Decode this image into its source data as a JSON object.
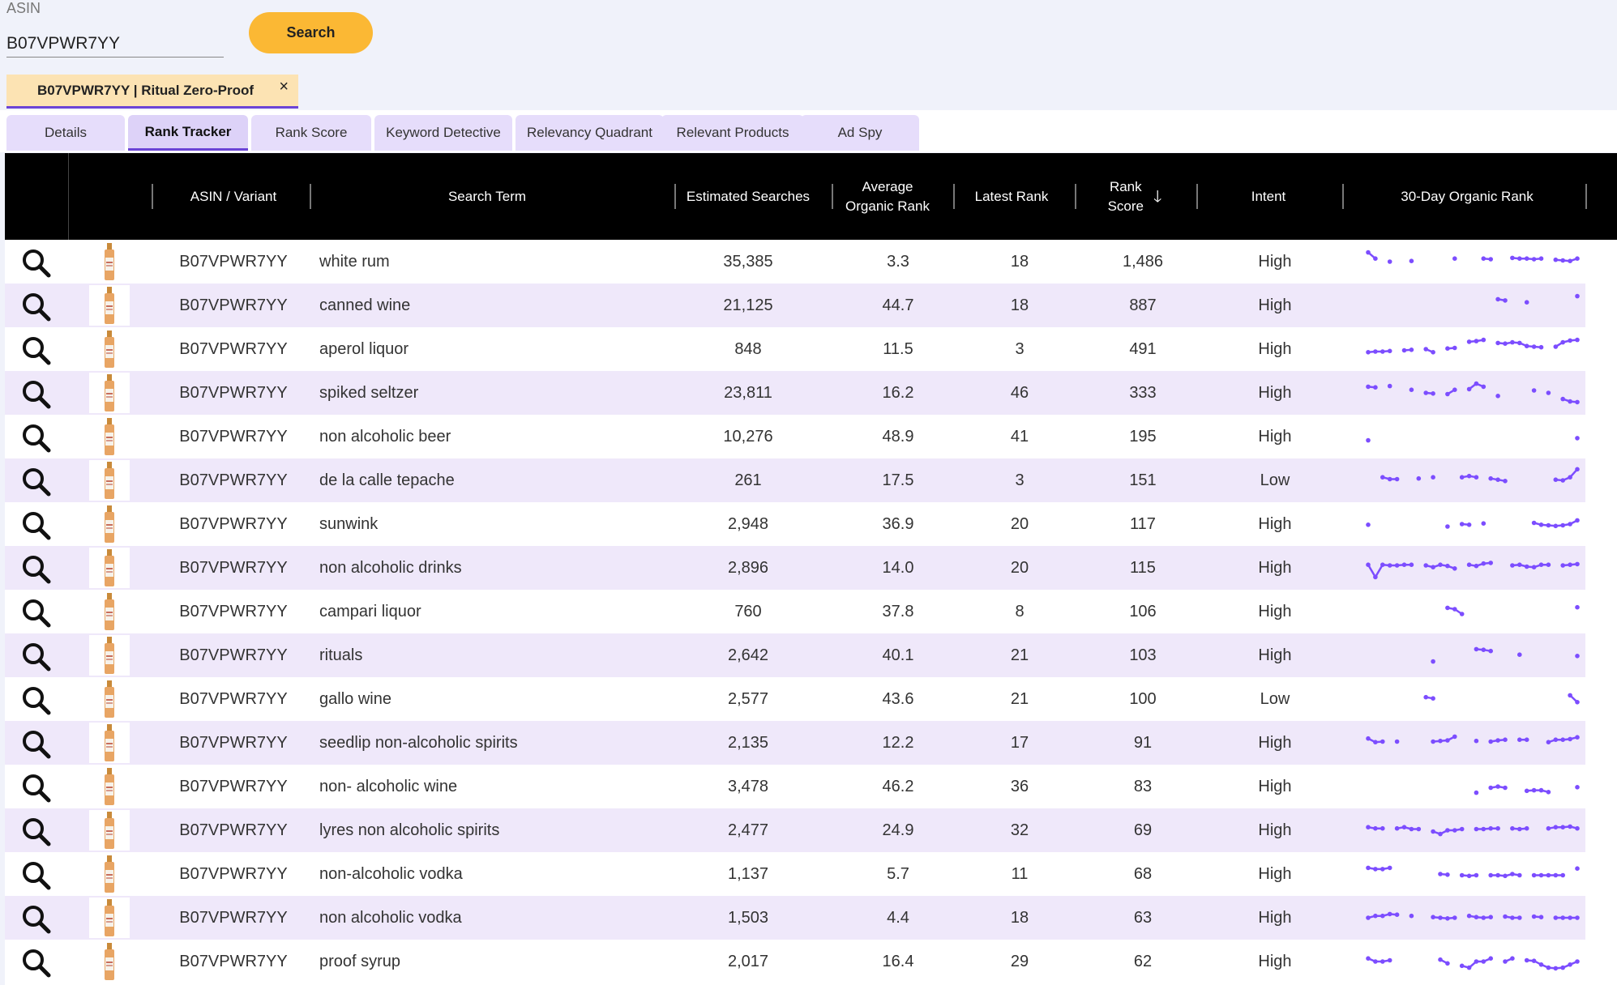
{
  "search": {
    "label": "ASIN",
    "value": "B07VPWR7YY",
    "button": "Search"
  },
  "chip": {
    "label": "B07VPWR7YY | Ritual Zero-Proof",
    "close": "×"
  },
  "tabs": [
    "Details",
    "Rank Tracker",
    "Rank Score",
    "Keyword Detective",
    "Relevancy Quadrant",
    "Relevant Products",
    "Ad Spy"
  ],
  "active_tab": "Rank Tracker",
  "columns": {
    "asin": "ASIN / Variant",
    "term": "Search Term",
    "est": "Estimated Searches",
    "avg1": "Average",
    "avg2": "Organic Rank",
    "latest": "Latest Rank",
    "rs1": "Rank",
    "rs2": "Score",
    "intent": "Intent",
    "spark": "30-Day Organic Rank"
  },
  "accent_color": "#7c4dff",
  "rows": [
    {
      "asin": "B07VPWR7YY",
      "term": "white rum",
      "est": "35,385",
      "avg": "3.3",
      "latest": "18",
      "score": "1,486",
      "intent": "High",
      "trend": [
        20,
        40,
        null,
        50,
        null,
        null,
        48,
        null,
        null,
        null,
        null,
        null,
        40,
        null,
        null,
        null,
        40,
        42,
        null,
        null,
        38,
        40,
        40,
        42,
        40,
        null,
        44,
        46,
        48,
        40
      ]
    },
    {
      "asin": "B07VPWR7YY",
      "term": "canned wine",
      "est": "21,125",
      "avg": "44.7",
      "latest": "18",
      "score": "887",
      "intent": "High",
      "trend": [
        null,
        null,
        null,
        null,
        null,
        null,
        null,
        null,
        null,
        null,
        null,
        null,
        null,
        null,
        null,
        null,
        null,
        null,
        30,
        34,
        null,
        null,
        40,
        null,
        null,
        null,
        null,
        null,
        null,
        20
      ]
    },
    {
      "asin": "B07VPWR7YY",
      "term": "aperol liquor",
      "est": "848",
      "avg": "11.5",
      "latest": "3",
      "score": "491",
      "intent": "High",
      "trend": [
        60,
        58,
        58,
        56,
        null,
        54,
        52,
        null,
        50,
        60,
        null,
        48,
        46,
        null,
        26,
        24,
        20,
        null,
        30,
        32,
        28,
        30,
        40,
        42,
        44,
        null,
        42,
        28,
        22,
        20
      ]
    },
    {
      "asin": "B07VPWR7YY",
      "term": "spiked seltzer",
      "est": "23,811",
      "avg": "16.2",
      "latest": "46",
      "score": "333",
      "intent": "High",
      "trend": [
        30,
        32,
        null,
        28,
        null,
        null,
        40,
        null,
        50,
        52,
        null,
        54,
        40,
        null,
        38,
        20,
        30,
        null,
        60,
        null,
        null,
        null,
        null,
        42,
        null,
        50,
        null,
        70,
        78,
        80
      ]
    },
    {
      "asin": "B07VPWR7YY",
      "term": "non alcoholic beer",
      "est": "10,276",
      "avg": "48.9",
      "latest": "41",
      "score": "195",
      "intent": "High",
      "trend": [
        62,
        null,
        null,
        null,
        null,
        null,
        null,
        null,
        null,
        null,
        null,
        null,
        null,
        null,
        null,
        null,
        null,
        null,
        null,
        null,
        null,
        null,
        null,
        null,
        null,
        null,
        null,
        null,
        null,
        55
      ]
    },
    {
      "asin": "B07VPWR7YY",
      "term": "de la calle tepache",
      "est": "261",
      "avg": "17.5",
      "latest": "3",
      "score": "151",
      "intent": "Low",
      "trend": [
        null,
        null,
        40,
        46,
        46,
        null,
        null,
        44,
        null,
        40,
        null,
        null,
        null,
        40,
        36,
        40,
        null,
        44,
        48,
        52,
        null,
        null,
        null,
        null,
        null,
        null,
        48,
        50,
        40,
        14
      ]
    },
    {
      "asin": "B07VPWR7YY",
      "term": "sunwink",
      "est": "2,948",
      "avg": "36.9",
      "latest": "20",
      "score": "117",
      "intent": "High",
      "trend": [
        52,
        null,
        null,
        null,
        null,
        null,
        null,
        null,
        null,
        null,
        null,
        58,
        null,
        50,
        52,
        null,
        48,
        null,
        null,
        null,
        null,
        null,
        null,
        46,
        52,
        54,
        56,
        54,
        50,
        38
      ]
    },
    {
      "asin": "B07VPWR7YY",
      "term": "non alcoholic drinks",
      "est": "2,896",
      "avg": "14.0",
      "latest": "20",
      "score": "115",
      "intent": "High",
      "trend": [
        40,
        80,
        40,
        42,
        42,
        40,
        40,
        null,
        42,
        48,
        40,
        44,
        52,
        null,
        40,
        44,
        36,
        34,
        null,
        null,
        42,
        40,
        46,
        48,
        40,
        40,
        null,
        42,
        40,
        38
      ]
    },
    {
      "asin": "B07VPWR7YY",
      "term": "campari liquor",
      "est": "760",
      "avg": "37.8",
      "latest": "8",
      "score": "106",
      "intent": "High",
      "trend": [
        null,
        null,
        null,
        null,
        null,
        null,
        null,
        null,
        null,
        null,
        null,
        38,
        42,
        58,
        null,
        null,
        null,
        null,
        null,
        null,
        null,
        null,
        null,
        null,
        null,
        null,
        null,
        null,
        null,
        36
      ]
    },
    {
      "asin": "B07VPWR7YY",
      "term": "rituals",
      "est": "2,642",
      "avg": "40.1",
      "latest": "21",
      "score": "103",
      "intent": "High",
      "trend": [
        null,
        null,
        null,
        null,
        null,
        null,
        null,
        null,
        null,
        70,
        null,
        null,
        null,
        null,
        null,
        30,
        32,
        36,
        null,
        null,
        null,
        48,
        null,
        null,
        null,
        null,
        null,
        null,
        null,
        52
      ]
    },
    {
      "asin": "B07VPWR7YY",
      "term": "gallo wine",
      "est": "2,577",
      "avg": "43.6",
      "latest": "21",
      "score": "100",
      "intent": "Low",
      "trend": [
        null,
        null,
        null,
        null,
        null,
        null,
        null,
        null,
        44,
        48,
        null,
        null,
        null,
        null,
        null,
        null,
        null,
        null,
        null,
        null,
        null,
        null,
        null,
        null,
        null,
        null,
        null,
        null,
        38,
        60
      ]
    },
    {
      "asin": "B07VPWR7YY",
      "term": "seedlip non-alcoholic spirits",
      "est": "2,135",
      "avg": "12.2",
      "latest": "17",
      "score": "91",
      "intent": "High",
      "trend": [
        36,
        48,
        46,
        null,
        46,
        null,
        null,
        null,
        null,
        46,
        44,
        42,
        30,
        null,
        null,
        44,
        null,
        46,
        42,
        40,
        null,
        40,
        40,
        null,
        null,
        48,
        40,
        40,
        38,
        32
      ]
    },
    {
      "asin": "B07VPWR7YY",
      "term": "non- alcoholic wine",
      "est": "3,478",
      "avg": "46.2",
      "latest": "36",
      "score": "83",
      "intent": "High",
      "trend": [
        null,
        null,
        null,
        null,
        null,
        null,
        null,
        null,
        null,
        null,
        null,
        null,
        null,
        null,
        null,
        70,
        null,
        54,
        50,
        54,
        null,
        null,
        64,
        62,
        62,
        68,
        null,
        null,
        null,
        52
      ]
    },
    {
      "asin": "B07VPWR7YY",
      "term": "lyres non alcoholic spirits",
      "est": "2,477",
      "avg": "24.9",
      "latest": "32",
      "score": "69",
      "intent": "High",
      "trend": [
        40,
        44,
        44,
        null,
        44,
        40,
        46,
        46,
        null,
        54,
        62,
        50,
        50,
        46,
        null,
        46,
        46,
        44,
        44,
        null,
        44,
        46,
        44,
        null,
        null,
        44,
        40,
        40,
        38,
        44
      ]
    },
    {
      "asin": "B07VPWR7YY",
      "term": "non-alcoholic vodka",
      "est": "1,137",
      "avg": "5.7",
      "latest": "11",
      "score": "68",
      "intent": "High",
      "trend": [
        30,
        34,
        34,
        30,
        null,
        null,
        null,
        null,
        null,
        null,
        50,
        52,
        null,
        54,
        56,
        54,
        null,
        54,
        54,
        56,
        50,
        54,
        null,
        54,
        54,
        54,
        54,
        54,
        null,
        32
      ]
    },
    {
      "asin": "B07VPWR7YY",
      "term": "non alcoholic vodka",
      "est": "1,503",
      "avg": "4.4",
      "latest": "18",
      "score": "63",
      "intent": "High",
      "trend": [
        50,
        44,
        44,
        38,
        40,
        null,
        44,
        null,
        null,
        48,
        50,
        52,
        50,
        null,
        44,
        48,
        50,
        48,
        null,
        46,
        50,
        50,
        null,
        46,
        48,
        null,
        50,
        50,
        50,
        50
      ]
    },
    {
      "asin": "B07VPWR7YY",
      "term": "proof syrup",
      "est": "2,017",
      "avg": "16.4",
      "latest": "29",
      "score": "62",
      "intent": "High",
      "trend": [
        40,
        50,
        50,
        46,
        null,
        null,
        null,
        null,
        null,
        null,
        44,
        56,
        null,
        64,
        70,
        50,
        50,
        40,
        null,
        50,
        40,
        null,
        46,
        48,
        60,
        70,
        72,
        70,
        60,
        50
      ]
    }
  ]
}
